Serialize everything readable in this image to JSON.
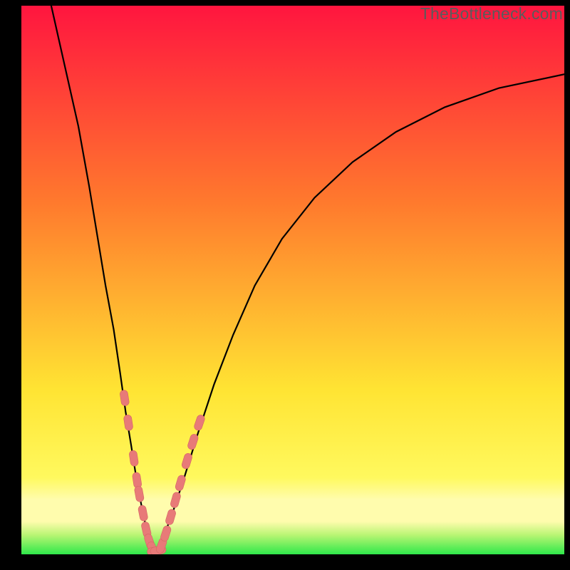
{
  "watermark": "TheBottleneck.com",
  "colors": {
    "frame": "#000000",
    "grad_top": "#ff153f",
    "grad_mid1": "#ff7a2d",
    "grad_mid2": "#ffe433",
    "grad_band_light": "#fffcad",
    "grad_bottom": "#2fe84a",
    "curve": "#000000",
    "marker_fill": "#e87a78",
    "marker_stroke": "#d46664",
    "watermark": "#5b5b5b"
  },
  "chart_data": {
    "type": "line",
    "title": "",
    "xlabel": "",
    "ylabel": "",
    "xlim": [
      0,
      100
    ],
    "ylim": [
      0,
      100
    ],
    "axis_ticks_visible": false,
    "grid": false,
    "annotations": [],
    "note": "No axis ticks or numeric labels are rendered in the image; values below are estimated from pixel positions relative to the plot area (0–100 normalized).",
    "series": [
      {
        "name": "bottleneck-curve-left",
        "x": [
          5.5,
          8,
          10.5,
          12.5,
          14,
          15.5,
          17,
          18.2,
          19.2,
          20.2,
          21,
          21.8,
          22.5,
          23.2,
          23.8,
          24.3
        ],
        "y": [
          100,
          89,
          78,
          67,
          58,
          49,
          41,
          33,
          26,
          20,
          15,
          10.5,
          7,
          4,
          1.8,
          0.5
        ]
      },
      {
        "name": "bottleneck-curve-right",
        "x": [
          24.3,
          25.2,
          26.5,
          28,
          30,
          32.5,
          35.5,
          39,
          43,
          48,
          54,
          61,
          69,
          78,
          88,
          100
        ],
        "y": [
          0.5,
          1.5,
          4,
          8,
          14,
          22,
          31,
          40,
          49,
          57.5,
          65,
          71.5,
          77,
          81.5,
          85,
          87.5
        ]
      }
    ],
    "markers": {
      "name": "highlight-segments",
      "shape": "rounded-pill",
      "color": "#e87a78",
      "points_left_branch": [
        {
          "x": 19.0,
          "y": 28.5
        },
        {
          "x": 19.7,
          "y": 24.0
        },
        {
          "x": 20.7,
          "y": 17.5
        },
        {
          "x": 21.3,
          "y": 13.5
        },
        {
          "x": 21.7,
          "y": 11.0
        },
        {
          "x": 22.4,
          "y": 7.5
        },
        {
          "x": 23.0,
          "y": 4.5
        },
        {
          "x": 23.6,
          "y": 2.3
        },
        {
          "x": 24.2,
          "y": 0.9
        }
      ],
      "points_bottom": [
        {
          "x": 24.6,
          "y": 0.6
        },
        {
          "x": 25.2,
          "y": 0.7
        }
      ],
      "points_right_branch": [
        {
          "x": 25.8,
          "y": 1.6
        },
        {
          "x": 26.6,
          "y": 3.8
        },
        {
          "x": 27.5,
          "y": 6.8
        },
        {
          "x": 28.4,
          "y": 9.9
        },
        {
          "x": 29.3,
          "y": 13.0
        },
        {
          "x": 30.5,
          "y": 17.0
        },
        {
          "x": 31.6,
          "y": 20.5
        },
        {
          "x": 32.8,
          "y": 24.0
        }
      ]
    }
  }
}
